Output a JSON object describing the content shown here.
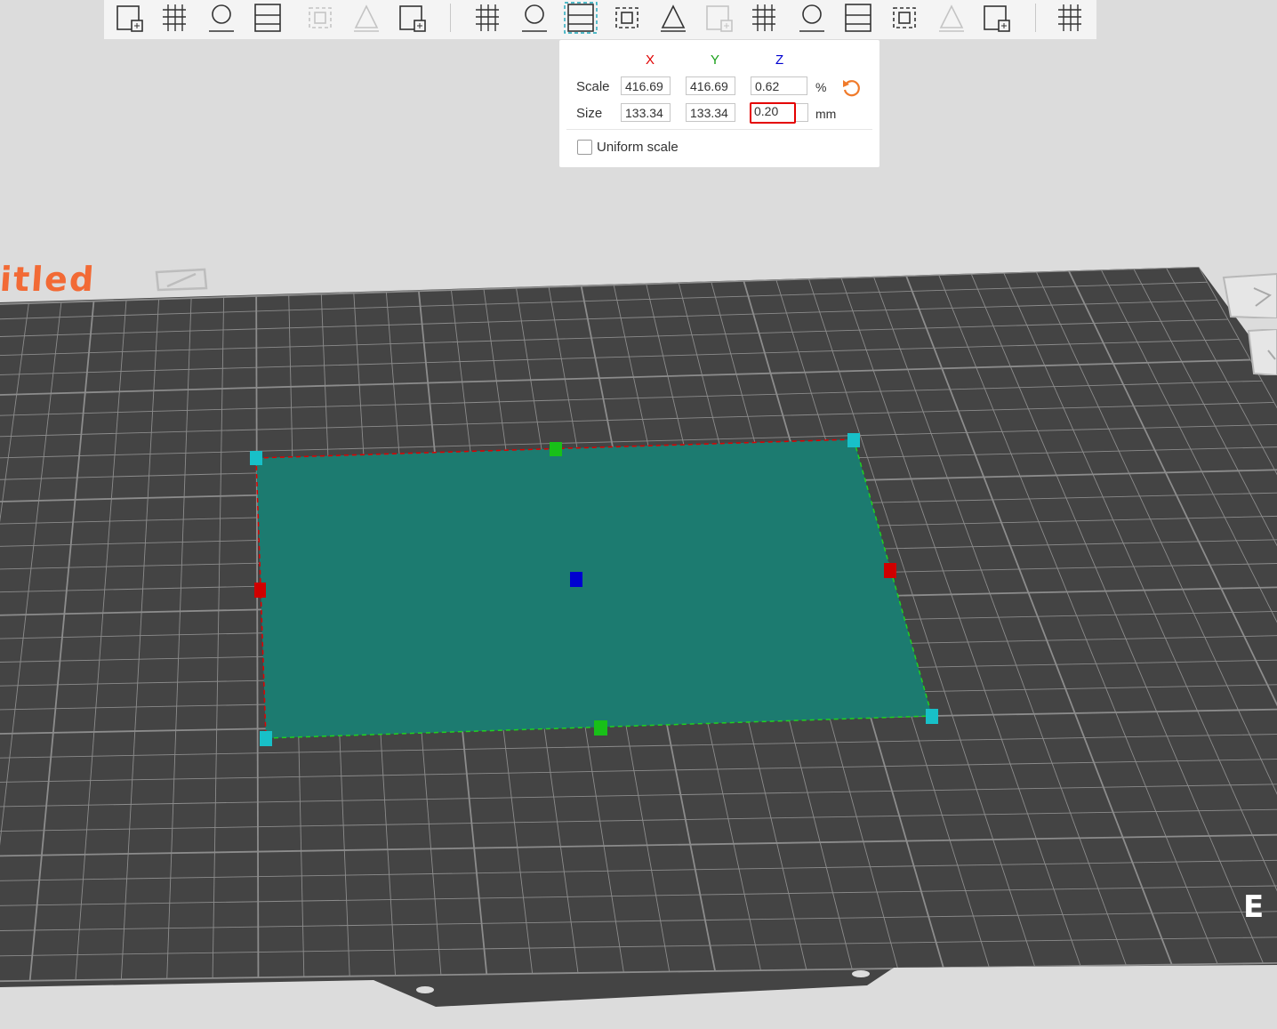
{
  "toolbar": {
    "tools": [
      {
        "name": "add-object-icon",
        "enabled": true
      },
      {
        "name": "add-plate-icon",
        "enabled": true
      },
      {
        "name": "auto-orient-icon",
        "enabled": true
      },
      {
        "name": "arrange-icon",
        "enabled": true
      },
      {
        "name": "split-objects-icon",
        "enabled": false
      },
      {
        "name": "split-parts-icon",
        "enabled": false
      },
      {
        "name": "variable-layer-height-icon",
        "enabled": true
      },
      {
        "name": "move-icon",
        "enabled": true
      },
      {
        "name": "rotate-icon",
        "enabled": true
      },
      {
        "name": "scale-icon",
        "enabled": true,
        "active": true
      },
      {
        "name": "lay-on-face-icon",
        "enabled": true
      },
      {
        "name": "cut-icon",
        "enabled": true
      },
      {
        "name": "mesh-boolean-icon",
        "enabled": false
      },
      {
        "name": "support-painting-icon",
        "enabled": true
      },
      {
        "name": "seam-painting-icon",
        "enabled": true
      },
      {
        "name": "text-emboss-icon",
        "enabled": true
      },
      {
        "name": "measure-icon",
        "enabled": true
      },
      {
        "name": "assembly-icon",
        "enabled": false
      },
      {
        "name": "brim-ears-icon",
        "enabled": true
      },
      {
        "name": "puzzle-icon",
        "enabled": true
      }
    ]
  },
  "scale_panel": {
    "axes": {
      "x": "X",
      "y": "Y",
      "z": "Z"
    },
    "axis_colors": {
      "x": "#e00000",
      "y": "#18a018",
      "z": "#0000d0"
    },
    "scale_label": "Scale",
    "size_label": "Size",
    "scale": {
      "x": "416.69",
      "y": "416.69",
      "z": "0.62",
      "unit": "%"
    },
    "size": {
      "x": "133.34",
      "y": "133.34",
      "z": "0.20",
      "unit": "mm"
    },
    "uniform_label": "Uniform scale",
    "uniform_checked": false,
    "reset_icon": "reset-rotate-icon",
    "accent": "#f07a2a"
  },
  "plate": {
    "title": "itled",
    "title_color": "#f26a35",
    "surface_color": "#444444",
    "grid_color": "#8c8c8c",
    "edit_icon": "edit-pencil-icon",
    "logo_text": "E"
  },
  "object": {
    "fill_color": "#1c7b70",
    "bbox_edge_colors": {
      "x": "#e00000",
      "y": "#1fd11f"
    },
    "handle_colors": {
      "corner": "#18c0c8",
      "x": "#d00000",
      "y": "#18c018",
      "center": "#0000d0"
    }
  }
}
